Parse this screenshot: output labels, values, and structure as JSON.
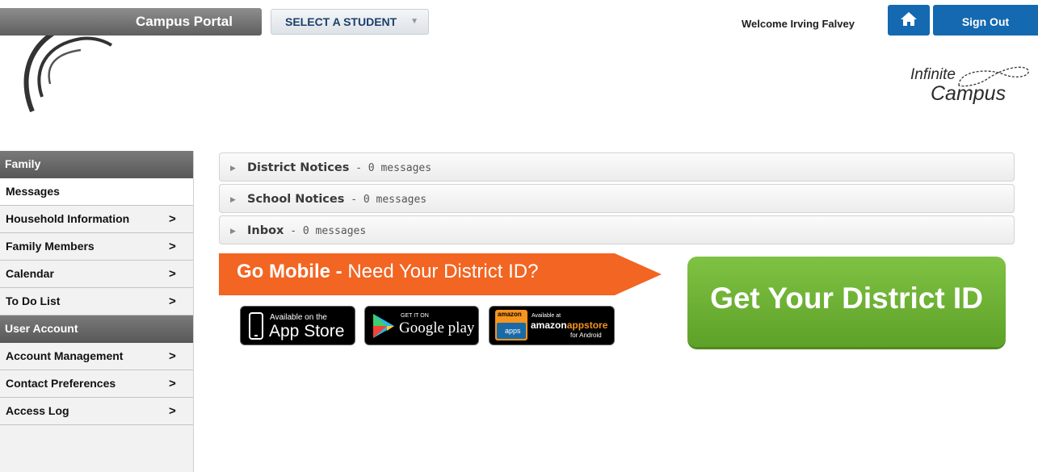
{
  "header": {
    "portal_title": "Campus Portal",
    "student_select": "SELECT A STUDENT",
    "welcome": "Welcome Irving Falvey",
    "sign_out": "Sign Out",
    "logo_line1": "Infinite",
    "logo_line2": "Campus",
    "brand_color": "#1469b1"
  },
  "sidebar": {
    "sections": [
      {
        "title": "Family",
        "items": [
          {
            "label": "Messages",
            "chevron": ""
          },
          {
            "label": "Household Information",
            "chevron": ">"
          },
          {
            "label": "Family Members",
            "chevron": ">"
          },
          {
            "label": "Calendar",
            "chevron": ">"
          },
          {
            "label": "To Do List",
            "chevron": ">"
          }
        ]
      },
      {
        "title": "User Account",
        "items": [
          {
            "label": "Account Management",
            "chevron": ">"
          },
          {
            "label": "Contact Preferences",
            "chevron": ">"
          },
          {
            "label": "Access Log",
            "chevron": ">"
          }
        ]
      }
    ]
  },
  "messages": [
    {
      "title": "District Notices",
      "count": " - 0 messages"
    },
    {
      "title": "School Notices",
      "count": " - 0 messages"
    },
    {
      "title": "Inbox",
      "count": " - 0 messages"
    }
  ],
  "mobile": {
    "banner_bold": "Go Mobile -",
    "banner_text": " Need Your District ID?",
    "banner_color": "#f26522",
    "apple_small": "Available on the",
    "apple_big": "App Store",
    "google_small": "GET IT ON",
    "google_big": "Google play",
    "amazon_logo": "amazon",
    "amazon_apps": "apps",
    "amazon_small": "Available at",
    "amazon_big_1": "amazon",
    "amazon_big_2": "appstore",
    "amazon_for": "for Android",
    "district_button": "Get Your District ID",
    "district_color": "#6db33f"
  }
}
